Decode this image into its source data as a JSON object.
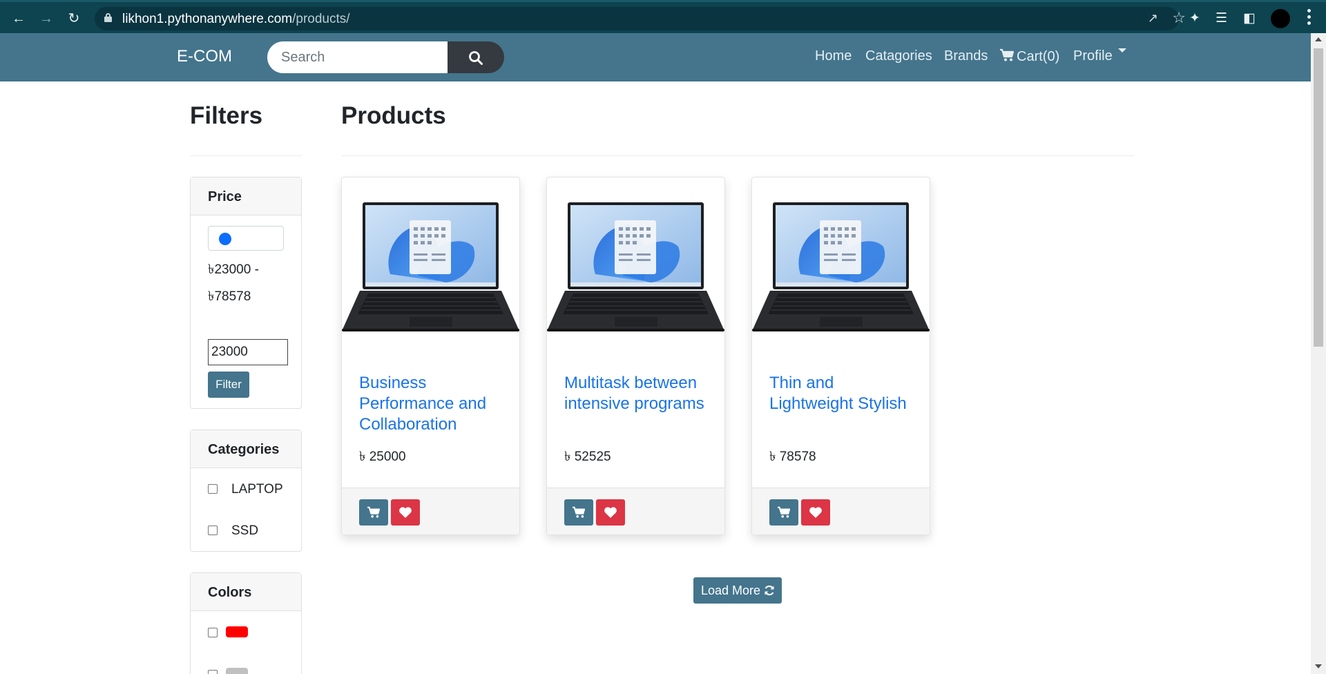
{
  "browser": {
    "url_domain": "likhon1.pythonanywhere.com",
    "url_path": "/products/"
  },
  "navbar": {
    "brand": "E-COM",
    "search_placeholder": "Search",
    "links": {
      "home": "Home",
      "categories": "Catagories",
      "brands": "Brands",
      "cart": "Cart(0)",
      "profile": "Profile"
    }
  },
  "filters": {
    "heading": "Filters",
    "price": {
      "title": "Price",
      "range_min_label": "৳23000 -",
      "range_max_label": "৳78578",
      "min_value": "23000",
      "button": "Filter"
    },
    "categories": {
      "title": "Categories",
      "items": [
        "LAPTOP",
        "SSD"
      ]
    },
    "colors": {
      "title": "Colors",
      "swatches": [
        "#ff0000",
        "#c0c0c0"
      ]
    }
  },
  "products": {
    "heading": "Products",
    "items": [
      {
        "title": "Business Performance and Collaboration",
        "price": "৳ 25000"
      },
      {
        "title": "Multitask between intensive programs",
        "price": "৳ 52525"
      },
      {
        "title": "Thin and Lightweight Stylish",
        "price": "৳ 78578"
      }
    ],
    "load_more": "Load More"
  },
  "colors": {
    "navbar": "#44758d",
    "link": "#1a73e8",
    "danger": "#dc3545"
  }
}
